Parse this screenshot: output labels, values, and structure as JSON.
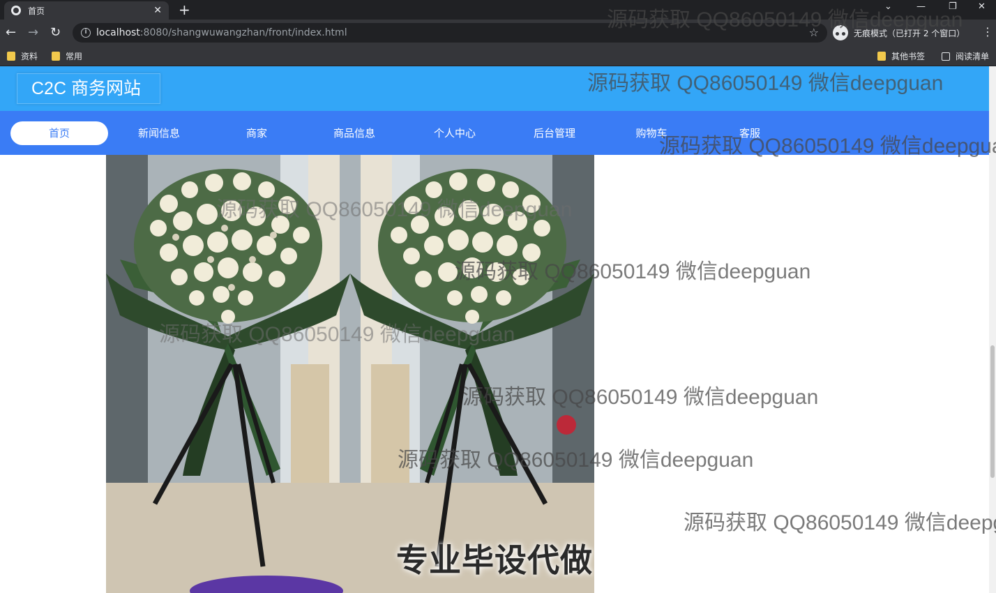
{
  "browser": {
    "tab_title": "首页",
    "url_host": "localhost",
    "url_path": ":8080/shangwuwangzhan/front/index.html",
    "incognito_label": "无痕模式（已打开 2 个窗口）",
    "bookmarks": [
      "资料",
      "常用"
    ],
    "bookmarks_right": [
      "其他书签",
      "阅读清单"
    ]
  },
  "site": {
    "brand": "C2C 商务网站",
    "nav": [
      {
        "label": "首页",
        "active": true
      },
      {
        "label": "新闻信息"
      },
      {
        "label": "商家"
      },
      {
        "label": "商品信息"
      },
      {
        "label": "个人中心"
      },
      {
        "label": "后台管理"
      },
      {
        "label": "购物车"
      },
      {
        "label": "客服"
      }
    ]
  },
  "banner": {
    "caption": "专业毕设代做"
  },
  "watermark": {
    "text": "源码获取 QQ86050149 微信deepguan"
  }
}
